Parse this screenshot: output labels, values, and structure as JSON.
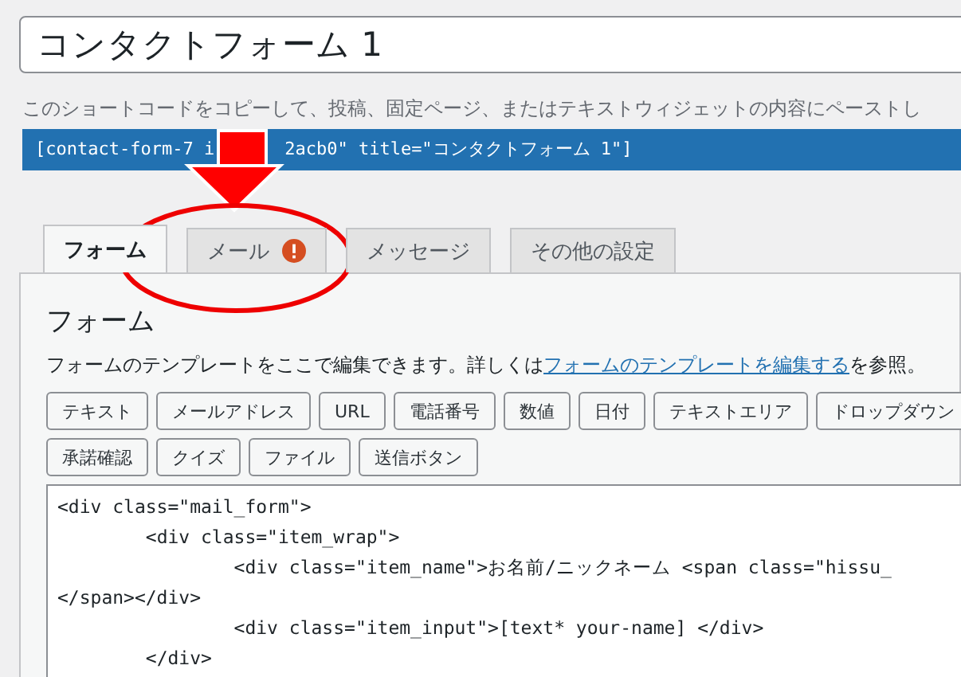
{
  "title_field": {
    "value": "コンタクトフォーム 1"
  },
  "shortcode_hint": "このショートコードをコピーして、投稿、固定ページ、またはテキストウィジェットの内容にペーストし",
  "shortcode": {
    "before": "[contact-form-7 i",
    "after": "2acb0\" title=\"コンタクトフォーム 1\"]"
  },
  "tabs": [
    {
      "label": "フォーム",
      "selected": true,
      "warning": false
    },
    {
      "label": "メール",
      "selected": false,
      "warning": true
    },
    {
      "label": "メッセージ",
      "selected": false,
      "warning": false
    },
    {
      "label": "その他の設定",
      "selected": false,
      "warning": false
    }
  ],
  "panel": {
    "heading": "フォーム",
    "description": {
      "before": "フォームのテンプレートをここで編集できます。詳しくは",
      "link": "フォームのテンプレートを編集する",
      "after": "を参照。"
    },
    "tag_buttons": [
      [
        "テキスト",
        "メールアドレス",
        "URL",
        "電話番号",
        "数値",
        "日付",
        "テキストエリア",
        "ドロップダウン"
      ],
      [
        "承諾確認",
        "クイズ",
        "ファイル",
        "送信ボタン"
      ]
    ],
    "code_lines": [
      "<div class=\"mail_form\">",
      "\t<div class=\"item_wrap\">",
      "\t\t<div class=\"item_name\">お名前/ニックネーム <span class=\"hissu_",
      "</span></div>",
      "\t\t<div class=\"item_input\">[text* your-name] </div>",
      "\t</div>"
    ]
  }
}
